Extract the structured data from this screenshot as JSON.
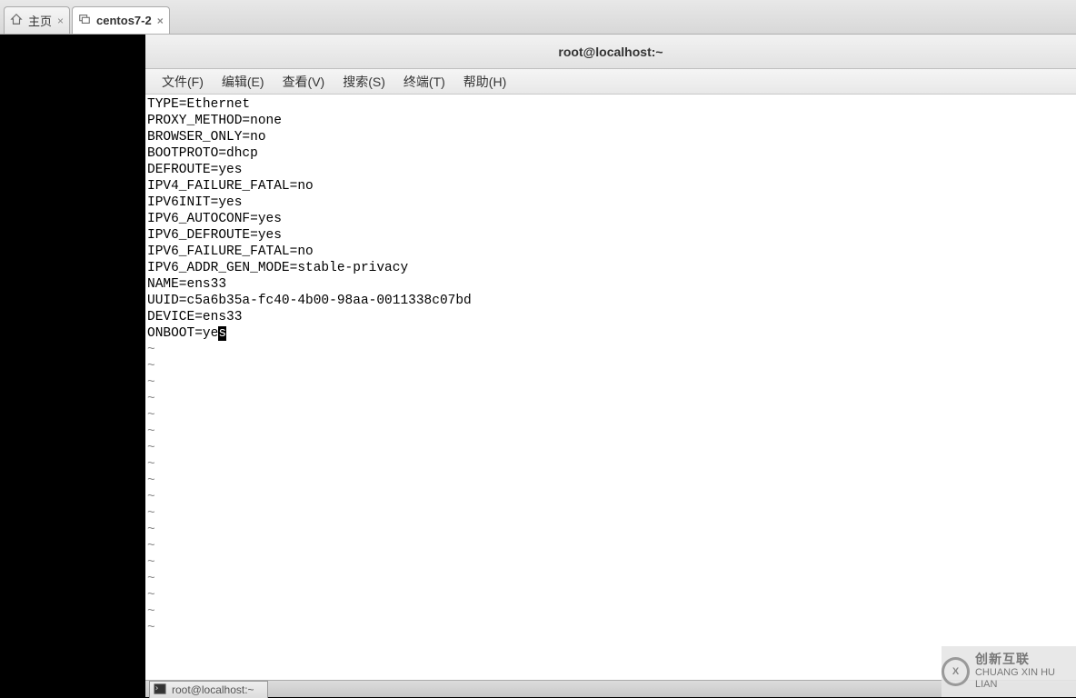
{
  "tabs": [
    {
      "label": "主页",
      "icon": "home",
      "active": false
    },
    {
      "label": "centos7-2",
      "icon": "vm",
      "active": true
    }
  ],
  "window_title": "root@localhost:~",
  "menu": {
    "file": "文件(F)",
    "edit": "编辑(E)",
    "view": "查看(V)",
    "search": "搜索(S)",
    "terminal": "终端(T)",
    "help": "帮助(H)"
  },
  "editor": {
    "lines": [
      "TYPE=Ethernet",
      "PROXY_METHOD=none",
      "BROWSER_ONLY=no",
      "BOOTPROTO=dhcp",
      "DEFROUTE=yes",
      "IPV4_FAILURE_FATAL=no",
      "IPV6INIT=yes",
      "IPV6_AUTOCONF=yes",
      "IPV6_DEFROUTE=yes",
      "IPV6_FAILURE_FATAL=no",
      "IPV6_ADDR_GEN_MODE=stable-privacy",
      "NAME=ens33",
      "UUID=c5a6b35a-fc40-4b00-98aa-0011338c07bd",
      "DEVICE=ens33"
    ],
    "last_line_prefix": "ONBOOT=ye",
    "last_line_cursor_char": "s",
    "tilde_count": 18
  },
  "taskbar": {
    "app_label": "root@localhost:~"
  },
  "watermark": {
    "brand": "创新互联",
    "sub": "CHUANG XIN HU LIAN",
    "mark": "X"
  }
}
